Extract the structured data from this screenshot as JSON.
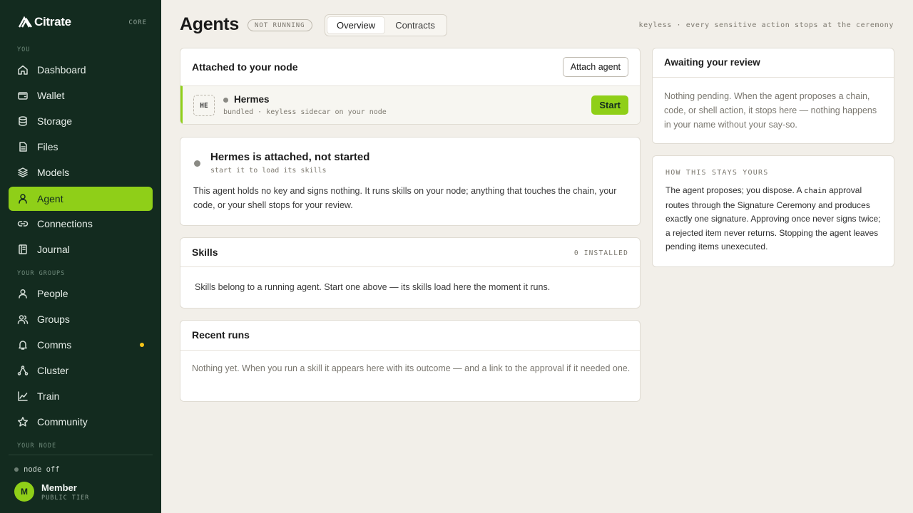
{
  "brand": {
    "name": "Citrate",
    "tag": "CORE"
  },
  "sidebar": {
    "section_you": "YOU",
    "section_groups": "YOUR GROUPS",
    "section_node": "YOUR NODE",
    "items": [
      {
        "label": "Dashboard",
        "icon": "home-icon"
      },
      {
        "label": "Wallet",
        "icon": "wallet-icon"
      },
      {
        "label": "Storage",
        "icon": "database-icon"
      },
      {
        "label": "Files",
        "icon": "file-icon"
      },
      {
        "label": "Models",
        "icon": "layers-icon"
      },
      {
        "label": "Agent",
        "icon": "agent-icon",
        "active": true
      },
      {
        "label": "Connections",
        "icon": "link-icon"
      },
      {
        "label": "Journal",
        "icon": "book-icon"
      }
    ],
    "group_items": [
      {
        "label": "People",
        "icon": "user-icon"
      },
      {
        "label": "Groups",
        "icon": "users-icon"
      },
      {
        "label": "Comms",
        "icon": "bell-icon",
        "badge": true
      },
      {
        "label": "Cluster",
        "icon": "cluster-icon"
      },
      {
        "label": "Train",
        "icon": "chart-icon"
      },
      {
        "label": "Community",
        "icon": "star-icon"
      }
    ],
    "node_status": "node off",
    "user": {
      "initial": "M",
      "name": "Member",
      "tier": "PUBLIC TIER"
    }
  },
  "header": {
    "title": "Agents",
    "status": "NOT RUNNING",
    "tabs": [
      {
        "label": "Overview",
        "active": true
      },
      {
        "label": "Contracts"
      }
    ],
    "note": "keyless · every sensitive action stops at the ceremony"
  },
  "attached": {
    "title": "Attached to your node",
    "attach_button": "Attach agent",
    "agent": {
      "badge": "HE",
      "name": "Hermes",
      "meta": "bundled · keyless sidecar on your node",
      "start_button": "Start"
    }
  },
  "status_card": {
    "title": "Hermes is attached, not started",
    "subtitle": "start it to load its skills",
    "body": "This agent holds no key and signs nothing. It runs skills on your node; anything that touches the chain, your code, or your shell stops for your review."
  },
  "skills": {
    "title": "Skills",
    "count": "0 INSTALLED",
    "empty": "Skills belong to a running agent. Start one above — its skills load here the moment it runs."
  },
  "recent_runs": {
    "title": "Recent runs",
    "empty": "Nothing yet. When you run a skill it appears here with its outcome — and a link to the approval if it needed one."
  },
  "review": {
    "title": "Awaiting your review",
    "empty": "Nothing pending. When the agent proposes a chain, code, or shell action, it stops here — nothing happens in your name without your say-so."
  },
  "how": {
    "title": "HOW THIS STAYS YOURS",
    "p1": "The agent proposes; you dispose. A ",
    "code": "chain",
    "p2": " approval routes through the Signature Ceremony and produces exactly one signature. Approving once never signs twice; a rejected item never returns. Stopping the agent leaves pending items unexecuted."
  },
  "colors": {
    "sidebar_bg": "#132b1f",
    "accent": "#8fcf18",
    "page_bg": "#f2efe9",
    "badge_dot": "#f5c518"
  }
}
